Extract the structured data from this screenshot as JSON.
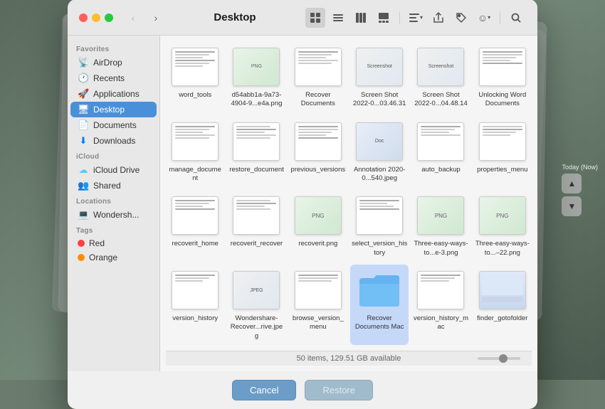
{
  "window": {
    "title": "Desktop"
  },
  "sidebar": {
    "favorites_label": "Favorites",
    "icloud_label": "iCloud",
    "locations_label": "Locations",
    "tags_label": "Tags",
    "items": {
      "airdrop": "AirDrop",
      "recents": "Recents",
      "applications": "Applications",
      "desktop": "Desktop",
      "documents": "Documents",
      "downloads": "Downloads",
      "icloud_drive": "iCloud Drive",
      "shared": "Shared",
      "wondershare": "Wondersh...",
      "red": "Red",
      "orange": "Orange"
    }
  },
  "toolbar": {
    "back": "‹",
    "forward": "›",
    "view_grid": "⊞",
    "view_list": "☰",
    "view_columns": "⊟",
    "view_cover": "⊡",
    "view_more": "⊞",
    "share": "↑",
    "tag": "🏷",
    "emoji": "☺",
    "search": "🔍"
  },
  "status_bar": {
    "text": "50 items, 129.51 GB available"
  },
  "buttons": {
    "cancel": "Cancel",
    "restore": "Restore"
  },
  "notification": {
    "label": "Today (Now)"
  },
  "files": [
    {
      "name": "word_tools",
      "type": "doc"
    },
    {
      "name": "d54abb1a-9a73-4904-9...e4a.png",
      "type": "png"
    },
    {
      "name": "Recover Documents",
      "type": "doc"
    },
    {
      "name": "Screen Shot 2022-0...03.46.31",
      "type": "screenshot"
    },
    {
      "name": "Screen Shot 2022-0...04.48.14",
      "type": "screenshot"
    },
    {
      "name": "Unlocking Word Documents",
      "type": "doc"
    },
    {
      "name": "manage_document",
      "type": "doc"
    },
    {
      "name": "restore_document",
      "type": "doc"
    },
    {
      "name": "previous_versions",
      "type": "doc"
    },
    {
      "name": "Annotation 2020-0...540.jpeg",
      "type": "jpeg"
    },
    {
      "name": "auto_backup",
      "type": "doc"
    },
    {
      "name": "properties_menu",
      "type": "doc"
    },
    {
      "name": "recoverit_home",
      "type": "doc"
    },
    {
      "name": "recoverit_recover",
      "type": "doc"
    },
    {
      "name": "recoverit.png",
      "type": "png"
    },
    {
      "name": "select_version_history",
      "type": "doc"
    },
    {
      "name": "Three-easy-ways-to...e-3.png",
      "type": "png"
    },
    {
      "name": "Three-easy-ways-to...–22.png",
      "type": "png"
    },
    {
      "name": "version_history",
      "type": "doc"
    },
    {
      "name": "Wondershare-Recover...rive.jpeg",
      "type": "jpeg"
    },
    {
      "name": "browse_version_menu",
      "type": "doc"
    },
    {
      "name": "Recover Documents Mac",
      "type": "folder"
    },
    {
      "name": "version_history_mac",
      "type": "doc"
    },
    {
      "name": "finder_gotofolder",
      "type": "doc"
    }
  ]
}
